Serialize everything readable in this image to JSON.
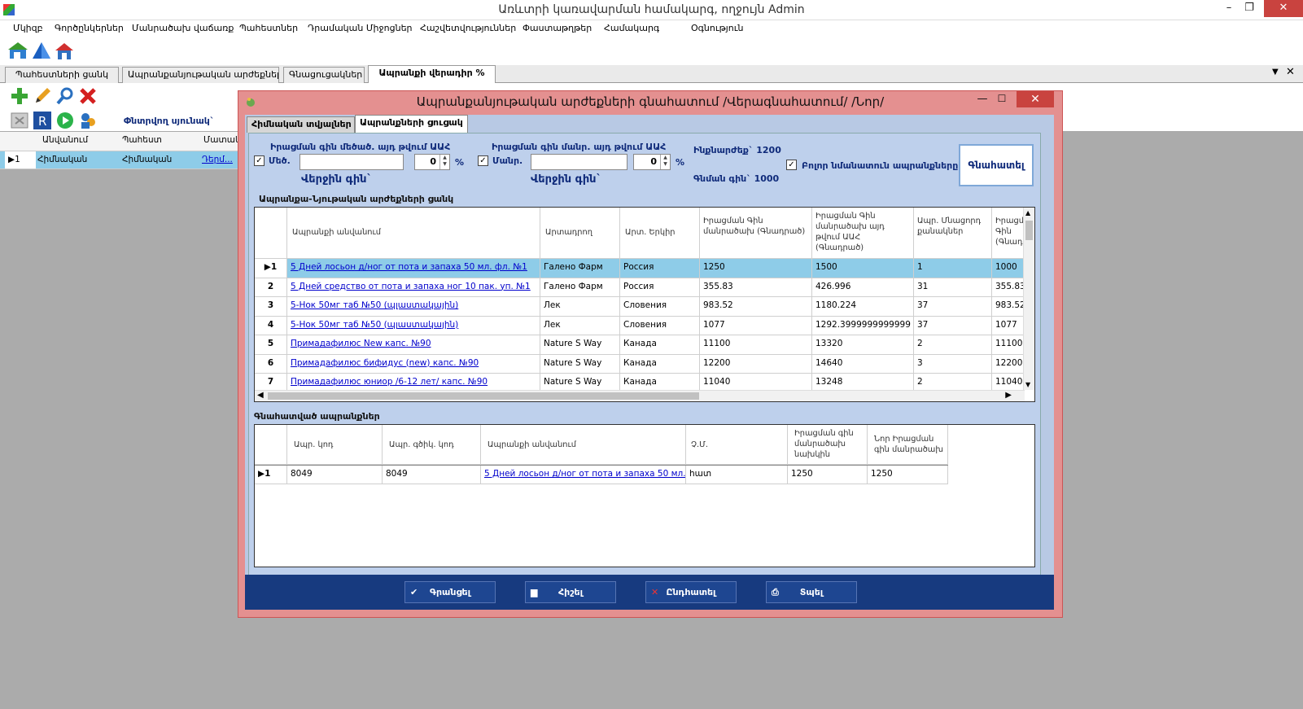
{
  "app": {
    "title": "Առևտրի կառավարման համակարգ, ողջույն Admin"
  },
  "window_controls": {
    "minimize": "–",
    "maximize": "❐",
    "close": "✕"
  },
  "menu": [
    "Մկիզբ",
    "Գործընկերներ",
    "Մանրածախ վաճառք",
    "Պահեստներ",
    "Դրամական Միջոցներ",
    "Հաշվետվություններ",
    "Փաստաթղթեր",
    "Համակարգ",
    "Օգնություն"
  ],
  "tabs": [
    "Պահեստների ցանկ",
    "Ապրանքանյութական արժեքներ...",
    "Գնացուցակներ",
    "Ապրանքի վերադիր %"
  ],
  "toolbar": {
    "search_column_label": "Փնտրվող սյունակ`"
  },
  "bg_grid": {
    "headers": [
      "Անվանում",
      "Պահեստ",
      "Մատակ"
    ],
    "row": {
      "num": "1",
      "name": "Հիմնական",
      "warehouse": "Հիմնական",
      "supplier": "Դերմ..."
    }
  },
  "modal": {
    "title": "Ապրանքանյութական արժեքների գնահատում /Վերագնահատում/ /Նոր/",
    "tabs": [
      "Հիմնական տվյալներ",
      "Ապրանքների ցուցակ"
    ],
    "wholesale_label_1": "Իրացման գին մեծած. այդ թվում ԱԱՀ",
    "wholesale_label_2": "Մեծ.",
    "retail_label_1": "Իրացման գին մանր. այդ թվում ԱԱՀ",
    "retail_label_2": "Մանր.",
    "wholesale_value": "",
    "retail_value": "",
    "wholesale_pct": "0",
    "retail_pct": "0",
    "pct_sign": "%",
    "last_price_label": "Վերջին գին`",
    "cost_label": "Ինքնարժեք` 1200",
    "buy_price_label": "Գնման գին` 1000",
    "all_selected_label": "Բոլոր նմանատուն ապրանքները",
    "calc_button": "Գնահատել",
    "goods_section": "Ապրանքա-Նյութական արժեքների ցանկ",
    "goods_headers": [
      "Ապրանքի անվանում",
      "Արտադրող",
      "Արտ. Երկիր",
      "Իրացման Գին մանրածախ (Գնադրած)",
      "Իրացման Գին մանրածախ այդ թվում ԱԱՀ (Գնադրած)",
      "Ապր. Մնացորդ քանակներ",
      "Իրացման Գին (Գնադ"
    ],
    "goods_rows": [
      {
        "n": "1",
        "name": "5 Дней лосьон д/ног от пота и запаха 50 мл. фл. №1",
        "maker": "Галено Фарм",
        "country": "Россия",
        "p1": "1250",
        "p2": "1500",
        "qty": "1",
        "p3": "1000"
      },
      {
        "n": "2",
        "name": "5 Дней средство от пота и запаха ног 10 пак. уп. №1",
        "maker": "Галено Фарм",
        "country": "Россия",
        "p1": "355.83",
        "p2": "426.996",
        "qty": "31",
        "p3": "355.83"
      },
      {
        "n": "3",
        "name": "5-Нок 50мг таб №50 (պլաստակային)",
        "maker": "Лек",
        "country": "Словения",
        "p1": "983.52",
        "p2": "1180.224",
        "qty": "37",
        "p3": "983.52"
      },
      {
        "n": "4",
        "name": "5-Нок 50мг таб №50 (պլաստակային)",
        "maker": "Лек",
        "country": "Словения",
        "p1": "1077",
        "p2": "1292.3999999999999",
        "qty": "37",
        "p3": "1077"
      },
      {
        "n": "5",
        "name": "Примадафилюс New капс. №90",
        "maker": "Nature S Way",
        "country": "Канада",
        "p1": "11100",
        "p2": "13320",
        "qty": "2",
        "p3": "11100"
      },
      {
        "n": "6",
        "name": "Примадафилюс бифидус (new) капс. №90",
        "maker": "Nature S Way",
        "country": "Канада",
        "p1": "12200",
        "p2": "14640",
        "qty": "3",
        "p3": "12200"
      },
      {
        "n": "7",
        "name": "Примадафилюс юниор /6-12 лет/ капс. №90",
        "maker": "Nature S Way",
        "country": "Канада",
        "p1": "11040",
        "p2": "13248",
        "qty": "2",
        "p3": "11040"
      }
    ],
    "valued_section": "Գնահատված ապրանքներ",
    "valued_headers": [
      "Ապր. կոդ",
      "Ապր. գծիկ. կոդ",
      "Ապրանքի անվանում",
      "Չ.Մ.",
      "Իրացման գին մանրածախ նախկին",
      "Նոր Իրացման գին մանրածախ"
    ],
    "valued_rows": [
      {
        "code": "8049",
        "barcode": "8049",
        "name": "5 Дней лосьон д/ног от пота и запаха 50 мл. фл....",
        "unit": "հատ",
        "old": "1250",
        "new": "1250"
      }
    ],
    "footer": [
      "Գրանցել",
      "Հիշել",
      "Ընդհատել",
      "Տպել"
    ]
  }
}
